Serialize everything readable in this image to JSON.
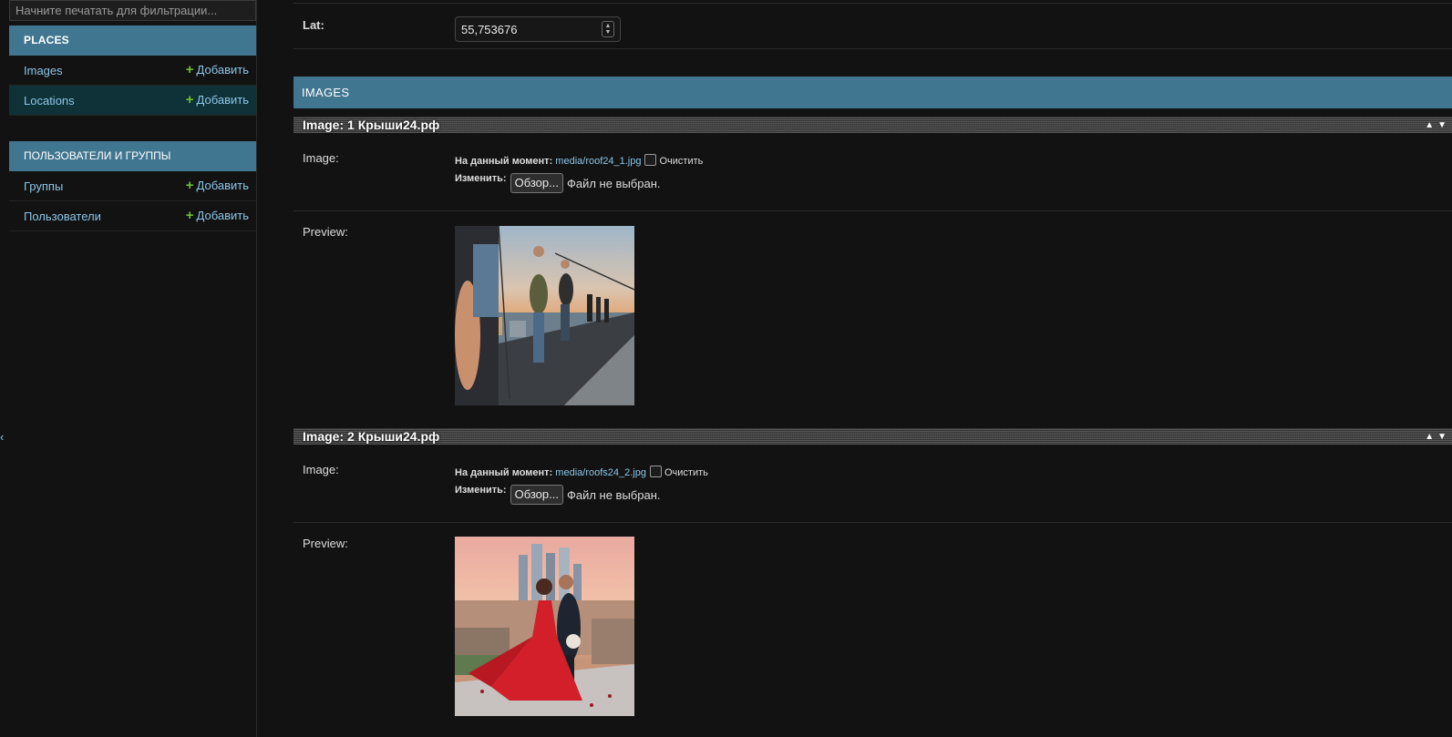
{
  "sidebar": {
    "filter_placeholder": "Начните печатать для фильтрации...",
    "modules": [
      {
        "caption": "PLACES",
        "rows": [
          {
            "label": "Images",
            "add": "Добавить"
          },
          {
            "label": "Locations",
            "add": "Добавить"
          }
        ]
      },
      {
        "caption": "ПОЛЬЗОВАТЕЛИ И ГРУППЫ",
        "rows": [
          {
            "label": "Группы",
            "add": "Добавить"
          },
          {
            "label": "Пользователи",
            "add": "Добавить"
          }
        ]
      }
    ],
    "collapse_glyph": "‹"
  },
  "form": {
    "lat_label": "Lat:",
    "lat_value": "55,753676"
  },
  "images_section": {
    "title": "IMAGES",
    "items": [
      {
        "header": "Image: 1 Крыши24.рф",
        "image_label": "Image:",
        "current_label": "На данный момент:",
        "current_link": "media/roof24_1.jpg",
        "clear_label": "Очистить",
        "change_label": "Изменить:",
        "browse_label": "Обзор...",
        "no_file_label": "Файл не выбран.",
        "preview_label": "Preview:"
      },
      {
        "header": "Image: 2 Крыши24.рф",
        "image_label": "Image:",
        "current_label": "На данный момент:",
        "current_link": "media/roofs24_2.jpg",
        "clear_label": "Очистить",
        "change_label": "Изменить:",
        "browse_label": "Обзор...",
        "no_file_label": "Файл не выбран.",
        "preview_label": "Preview:"
      }
    ]
  },
  "colors": {
    "accent": "#417690",
    "link": "#8bc6e8",
    "add_plus": "#70bf2b",
    "background": "#121212"
  }
}
